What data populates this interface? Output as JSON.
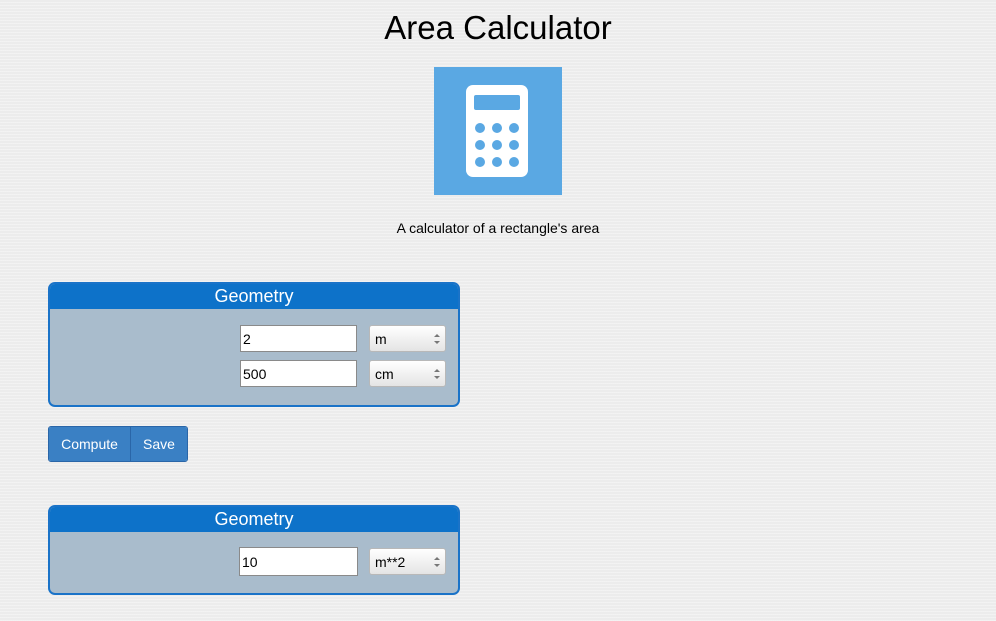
{
  "header": {
    "title": "Area Calculator",
    "logo_icon": "calculator-icon",
    "logo_bg": "#5aa8e3",
    "description": "A calculator of a rectangle's area"
  },
  "input_panel": {
    "title": "Geometry",
    "fields": [
      {
        "value": "2",
        "unit": "m"
      },
      {
        "value": "500",
        "unit": "cm"
      }
    ]
  },
  "actions": {
    "compute_label": "Compute",
    "save_label": "Save"
  },
  "output_panel": {
    "title": "Geometry",
    "fields": [
      {
        "value": "10",
        "unit": "m**2"
      }
    ]
  },
  "colors": {
    "panel_header": "#0d72c9",
    "panel_body": "#a9bccc",
    "button": "#3a80c4"
  }
}
